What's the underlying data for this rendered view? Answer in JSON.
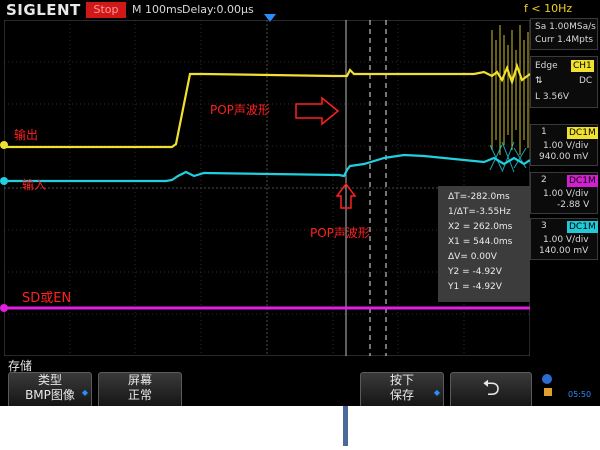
{
  "header": {
    "brand": "SIGLENT",
    "run_state": "Stop",
    "timebase": "M 100ms",
    "delay": "Delay:0.00μs",
    "trigger_freq": "f < 10Hz"
  },
  "acquisition": {
    "sample_rate": "Sa 1.00MSa/s",
    "memory": "Curr 1.4Mpts"
  },
  "trigger": {
    "type": "Edge",
    "source": "CH1",
    "slope_icon": "rising-falling-slope-icon",
    "coupling": "DC",
    "level": "L  3.56V"
  },
  "channels": [
    {
      "num": "1",
      "coupling": "DC1M",
      "scale": "1.00 V/div",
      "offset": "940.00 mV",
      "color": "#f0e030"
    },
    {
      "num": "2",
      "coupling": "DC1M",
      "scale": "1.00 V/div",
      "offset": "-2.88 V",
      "color": "#e020e0"
    },
    {
      "num": "3",
      "coupling": "DC1M",
      "scale": "1.00 V/div",
      "offset": "140.00 mV",
      "color": "#20d0e0"
    }
  ],
  "annotations": {
    "pop_top": "POP声波形",
    "pop_bottom": "POP声波形",
    "output": "输出",
    "input": "输入",
    "sd_en": "SD或EN"
  },
  "measurements": [
    "ΔT=-282.0ms",
    "1/ΔT=-3.55Hz",
    "X2 = 262.0ms",
    "X1 = 544.0ms",
    "ΔV= 0.00V",
    "Y2 = -4.92V",
    "Y1 = -4.92V"
  ],
  "menu": {
    "title": "存储",
    "buttons": [
      {
        "line1": "类型",
        "line2": "BMP图像"
      },
      {
        "line1": "屏幕",
        "line2": "正常"
      },
      {
        "line1": "按下",
        "line2": "保存"
      }
    ],
    "back_icon": "return-arrow-icon",
    "usb_icon": "usb-icon",
    "clock": "05:50"
  },
  "colors": {
    "ch1": "#f0e030",
    "ch2": "#e020e0",
    "ch3": "#20d0e0",
    "annotation": "#ff2020",
    "marker_bar": "#4a6a9a"
  }
}
